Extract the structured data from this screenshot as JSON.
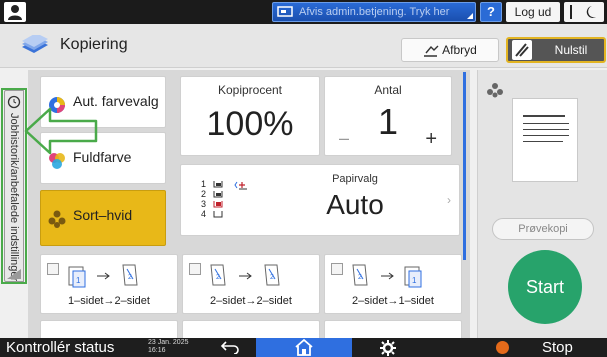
{
  "topbar": {
    "admin_banner": "Afvis admin.betjening. Tryk her",
    "help_label": "?",
    "logout_label": "Log ud"
  },
  "titlebar": {
    "title": "Kopiering",
    "interrupt_label": "Afbryd",
    "reset_label": "Nulstil"
  },
  "history_tab": {
    "label": "Jobhistorik/anbefalede indstillinger"
  },
  "color_modes": [
    {
      "label": "Aut. farvevalg",
      "selected": false
    },
    {
      "label": "Fuldfarve",
      "selected": false
    },
    {
      "label": "Sort–hvid",
      "selected": true
    }
  ],
  "ratio": {
    "label": "Kopiprocent",
    "value": "100%"
  },
  "quantity": {
    "label": "Antal",
    "value": "1",
    "minus": "–",
    "plus": "+"
  },
  "paper": {
    "label": "Papirvalg",
    "value": "Auto",
    "trays": [
      "1",
      "2",
      "3",
      "4"
    ]
  },
  "duplex": [
    {
      "label": "1–sidet→2–sidet"
    },
    {
      "label": "2–sidet→2–sidet"
    },
    {
      "label": "2–sidet→1–sidet"
    }
  ],
  "right_panel": {
    "sample_label": "Prøvekopi",
    "start_label": "Start"
  },
  "bottombar": {
    "status_label": "Kontrollér status",
    "date": "23 Jan. 2025",
    "time": "16:16",
    "stop_label": "Stop"
  },
  "colors": {
    "accent_blue": "#2f6fe0",
    "selected_yellow": "#e8b818",
    "start_green": "#27a36b",
    "highlight_green": "#4aaa4a"
  }
}
